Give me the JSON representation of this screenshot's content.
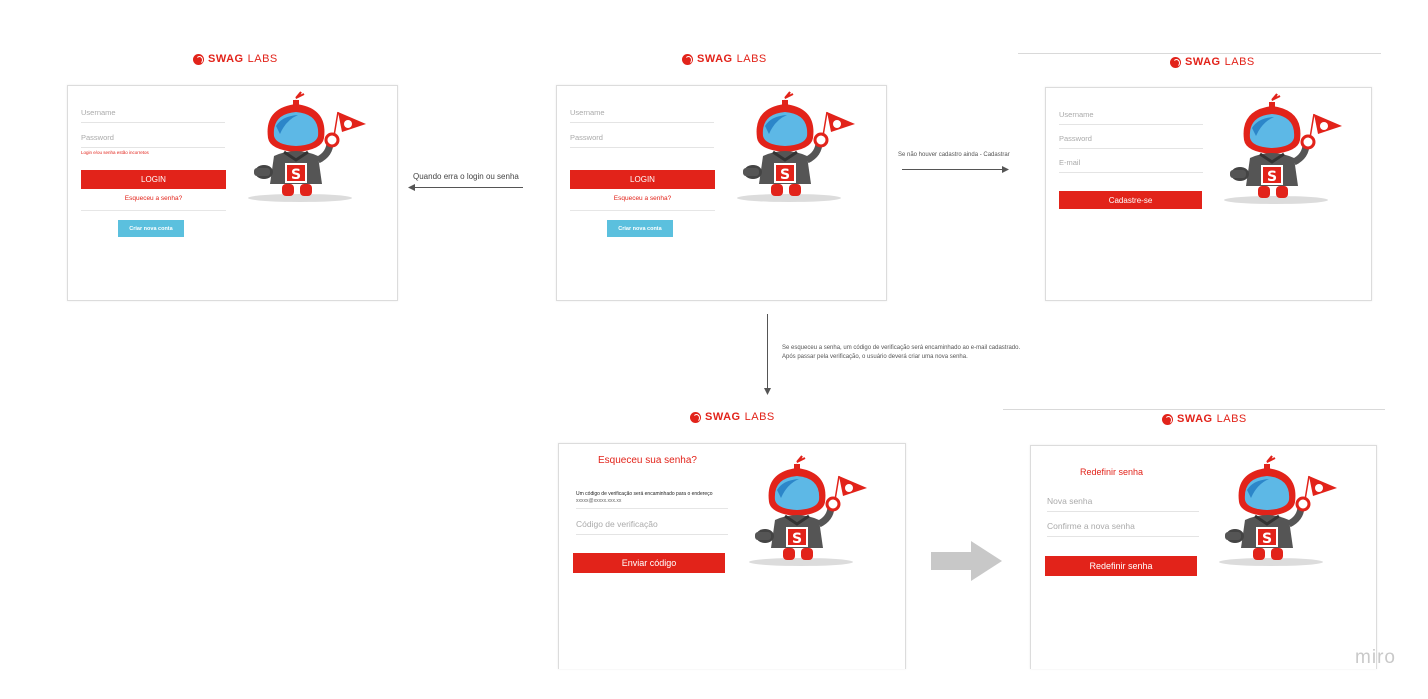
{
  "brand": {
    "swag": "SWAG",
    "labs": "LABS"
  },
  "login_error_screen": {
    "username": "Username",
    "password": "Password",
    "error": "Login e/ou senha estão incorretos",
    "login_button": "LOGIN",
    "forgot_link": "Esqueceu a senha?",
    "create_button": "Criar nova conta"
  },
  "login_screen": {
    "username": "Username",
    "password": "Password",
    "login_button": "LOGIN",
    "forgot_link": "Esqueceu a senha?",
    "create_button": "Criar nova conta"
  },
  "signup_screen": {
    "username": "Username",
    "password": "Password",
    "email": "E-mail",
    "submit_button": "Cadastre-se"
  },
  "forgot_screen": {
    "heading": "Esqueceu sua senha?",
    "info_line1": "Um código de verificação será encaminhado para o endereço",
    "info_line2": "xxxxx@xxxxx.xxx.xx",
    "code_field": "Código de verificação",
    "send_button": "Enviar código"
  },
  "reset_screen": {
    "heading": "Redefinir senha",
    "new_password": "Nova senha",
    "confirm_password": "Confirme a nova senha",
    "submit_button": "Redefinir senha"
  },
  "flow_notes": {
    "error_arrow": "Quando erra o login ou senha",
    "signup_arrow": "Se não houver cadastro ainda - Cadastrar",
    "forgot_line1": "Se esqueceu a senha, um código de verificação será encaminhado ao e-mail cadastrado.",
    "forgot_line2": "Após passar pela verificação, o usuário deverá criar uma nova senha."
  },
  "watermark": "miro",
  "colors": {
    "brand_red": "#e2231a",
    "button_blue": "#5bc0de",
    "arrow_gray": "#c8c8c8"
  }
}
